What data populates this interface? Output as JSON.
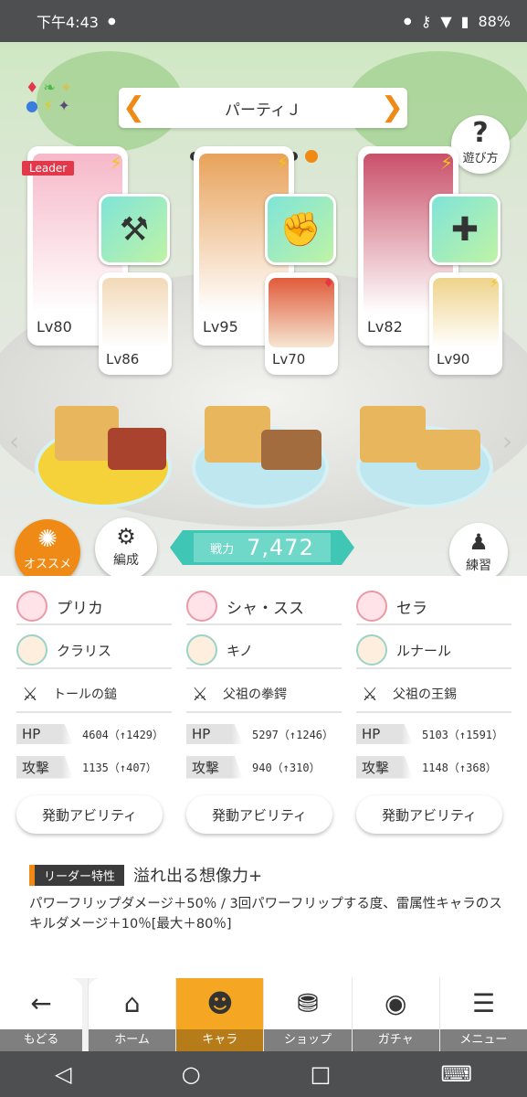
{
  "status": {
    "time": "下午4:43",
    "battery": "88%"
  },
  "header": {
    "party_name": "パーティＪ",
    "help_label": "遊び方",
    "dot_count": 8,
    "active_dot": 7
  },
  "elements": [
    "♦",
    "❧",
    "✦",
    "●",
    "⚡",
    "✦"
  ],
  "cards": [
    {
      "leader_label": "Leader",
      "main_level": "Lv80",
      "sub_level": "Lv86",
      "weapon_icon": "⚒",
      "sub_mark": ""
    },
    {
      "leader_label": "",
      "main_level": "Lv95",
      "sub_level": "Lv70",
      "weapon_icon": "✊",
      "sub_mark": "♦"
    },
    {
      "leader_label": "",
      "main_level": "Lv82",
      "sub_level": "Lv90",
      "weapon_icon": "✚",
      "sub_mark": "⚡"
    }
  ],
  "controls": {
    "recommend_label": "オススメ",
    "edit_label": "編成",
    "power_key": "戦力",
    "power_value": "7,472",
    "train_label": "練習"
  },
  "party": [
    {
      "main": "プリカ",
      "sub": "クラリス",
      "weapon": "トールの鎚",
      "hp_label": "HP",
      "hp": "4604（↑1429）",
      "atk_label": "攻撃",
      "atk": "1135（↑407）",
      "ability_label": "発動アビリティ"
    },
    {
      "main": "シャ・スス",
      "sub": "キノ",
      "weapon": "父祖の拳鍔",
      "hp_label": "HP",
      "hp": "5297（↑1246）",
      "atk_label": "攻撃",
      "atk": "940（↑310）",
      "ability_label": "発動アビリティ"
    },
    {
      "main": "セラ",
      "sub": "ルナール",
      "weapon": "父祖の王錫",
      "hp_label": "HP",
      "hp": "5103（↑1591）",
      "atk_label": "攻撃",
      "atk": "1148（↑368）",
      "ability_label": "発動アビリティ"
    }
  ],
  "leader_skill": {
    "tag": "リーダー特性",
    "title": "溢れ出る想像力+",
    "description": "パワーフリップダメージ＋50％ / 3回パワーフリップする度、雷属性キャラのスキルダメージ＋10％[最大＋80％]"
  },
  "nav": {
    "back": "もどる",
    "items": [
      "ホーム",
      "キャラ",
      "ショップ",
      "ガチャ",
      "メニュー"
    ],
    "active": "キャラ"
  },
  "colors": {
    "accent": "#f08a16",
    "teal": "#3fc6b5"
  }
}
